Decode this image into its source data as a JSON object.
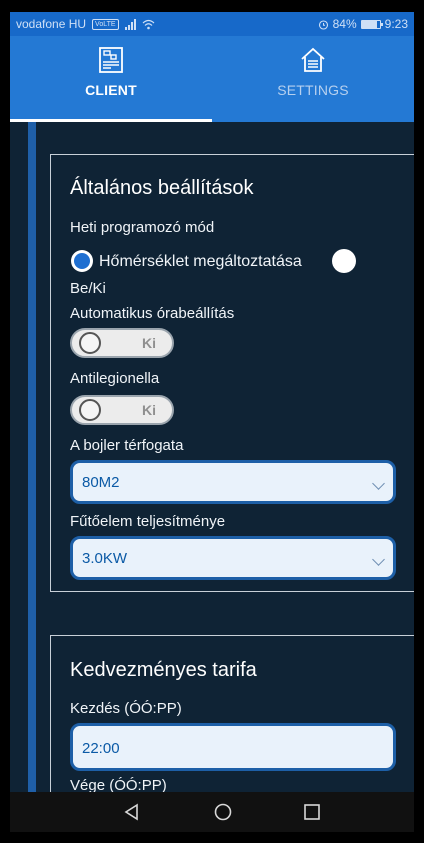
{
  "status_bar": {
    "carrier": "vodafone HU",
    "volte": "VoLTE",
    "battery_percent": "84%",
    "battery_level": 0.84,
    "time": "9:23"
  },
  "tabs": [
    {
      "label": "CLIENT",
      "icon": "client-panel-icon",
      "active": true
    },
    {
      "label": "SETTINGS",
      "icon": "home-settings-icon",
      "active": false
    }
  ],
  "general": {
    "title": "Általános beállítások",
    "weekly_mode_label": "Heti programozó mód",
    "radio_option_1": "Hőmérséklet megáltoztatása",
    "radio_option_2": "Be/Ki",
    "radio_selected": "Hőmérséklet megáltoztatása",
    "auto_clock_label": "Automatikus órabeállítás",
    "auto_clock_state": "Ki",
    "antilegionella_label": "Antilegionella",
    "antilegionella_state": "Ki",
    "volume_label": "A bojler térfogata",
    "volume_value": "80M2",
    "heater_power_label": "Fűtőelem teljesítménye",
    "heater_power_value": "3.0KW"
  },
  "tariff": {
    "title": "Kedvezményes tarifa",
    "start_label": "Kezdés (ÓÓ:PP)",
    "start_value": "22:00",
    "end_label": "Vége (ÓÓ:PP)",
    "end_value": ""
  },
  "navigation": {
    "back_icon": "back-triangle-icon",
    "home_icon": "home-circle-icon",
    "recents_icon": "recents-square-icon"
  },
  "colors": {
    "accent": "#2479d4",
    "status_bar": "#1769c9",
    "background": "#0f2335",
    "field_border": "#1d5fa7"
  }
}
